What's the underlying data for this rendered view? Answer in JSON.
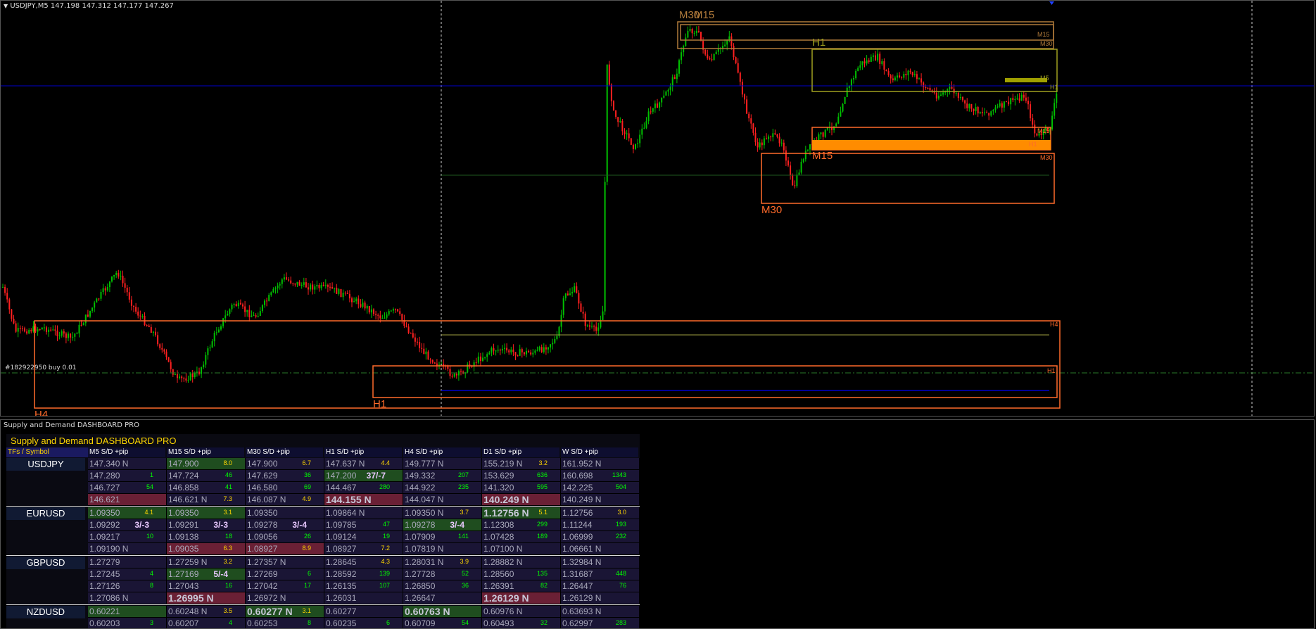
{
  "chart": {
    "title": "USDJPY,M5  147.198 147.312 147.177 147.267",
    "order_label": "#182922950 buy 0.01",
    "colors": {
      "bull": "#00c000",
      "bear": "#ff2020",
      "zone_orange": "#ff6a2a",
      "zone_tan": "#b07a3a",
      "zone_olive": "#a0a020",
      "fill_orange": "#ff8c00",
      "blue_line": "#0000cc",
      "grid_dashed": "#cccccc",
      "dashdot_green": "#2a7a2a"
    },
    "zone_labels": {
      "m30_m15_top": "M30",
      "m15_top": "M15",
      "h1_top": "H1",
      "m15_mid": "M15",
      "m30_mid": "M30",
      "h4_bottom": "H4",
      "h1_bottom": "H1"
    },
    "small_labels": {
      "m15_r1": "M15",
      "m30_r1": "M30",
      "m5_r": "M5",
      "h1_r": "H1",
      "m15_r2": "M15",
      "h1_r2": "H1",
      "m30_r2": "M30",
      "h4_r": "H4",
      "h1_r3": "H1"
    }
  },
  "panel": {
    "title": "Supply and Demand DASHBOARD PRO",
    "dashboard_title": "Supply and Demand DASHBOARD PRO",
    "col_first": "TFs / Symbol",
    "columns": [
      "M5 S/D +pip",
      "M15 S/D +pip",
      "M30 S/D +pip",
      "H1 S/D +pip",
      "H4 S/D +pip",
      "D1 S/D +pip",
      "W S/D +pip"
    ],
    "symbols": [
      {
        "name": "USDJPY",
        "rows": [
          [
            {
              "p": "147.340 N"
            },
            {
              "p": "147.900",
              "n": "8.0",
              "c": "y",
              "h": "g"
            },
            {
              "p": "147.900",
              "n": "6.7",
              "c": "y"
            },
            {
              "p": "147.637 N",
              "n": "4.4",
              "c": "y"
            },
            {
              "p": "149.777 N"
            },
            {
              "p": "155.219 N",
              "n": "3.2",
              "c": "y"
            },
            {
              "p": "161.952 N"
            }
          ],
          [
            {
              "p": "147.280",
              "n": "1",
              "c": "g"
            },
            {
              "p": "147.724",
              "n": "46",
              "c": "g"
            },
            {
              "p": "147.629",
              "n": "36",
              "c": "g"
            },
            {
              "p": "147.200",
              "r": "37/-7",
              "h": "g"
            },
            {
              "p": "149.332",
              "n": "207",
              "c": "g"
            },
            {
              "p": "153.629",
              "n": "636",
              "c": "g"
            },
            {
              "p": "160.698",
              "n": "1343",
              "c": "g"
            }
          ],
          [
            {
              "p": "146.727",
              "n": "54",
              "c": "g"
            },
            {
              "p": "146.858",
              "n": "41",
              "c": "g"
            },
            {
              "p": "146.580",
              "n": "69",
              "c": "g"
            },
            {
              "p": "144.467",
              "n": "280",
              "c": "g"
            },
            {
              "p": "144.922",
              "n": "235",
              "c": "g"
            },
            {
              "p": "141.320",
              "n": "595",
              "c": "g"
            },
            {
              "p": "142.225",
              "n": "504",
              "c": "g"
            }
          ],
          [
            {
              "p": "146.621",
              "h": "r"
            },
            {
              "p": "146.621 N",
              "n": "7.3",
              "c": "y"
            },
            {
              "p": "146.087 N",
              "n": "4.9",
              "c": "y"
            },
            {
              "p": "144.155 N",
              "h": "r",
              "b": 1
            },
            {
              "p": "144.047 N"
            },
            {
              "p": "140.249 N",
              "h": "r",
              "b": 1
            },
            {
              "p": "140.249 N"
            }
          ]
        ]
      },
      {
        "name": "EURUSD",
        "rows": [
          [
            {
              "p": "1.09350",
              "n": "4.1",
              "c": "y",
              "h": "g"
            },
            {
              "p": "1.09350",
              "n": "3.1",
              "c": "y",
              "h": "g"
            },
            {
              "p": "1.09350"
            },
            {
              "p": "1.09864 N"
            },
            {
              "p": "1.09350 N",
              "n": "3.7",
              "c": "y"
            },
            {
              "p": "1.12756 N",
              "n": "5.1",
              "c": "y",
              "h": "g",
              "b": 1
            },
            {
              "p": "1.12756",
              "n": "3.0",
              "c": "y"
            }
          ],
          [
            {
              "p": "1.09292",
              "r": "3/-3"
            },
            {
              "p": "1.09291",
              "r": "3/-3"
            },
            {
              "p": "1.09278",
              "r": "3/-4"
            },
            {
              "p": "1.09785",
              "n": "47",
              "c": "g"
            },
            {
              "p": "1.09278",
              "r": "3/-4",
              "h": "g"
            },
            {
              "p": "1.12308",
              "n": "299",
              "c": "g"
            },
            {
              "p": "1.11244",
              "n": "193",
              "c": "g"
            }
          ],
          [
            {
              "p": "1.09217",
              "n": "10",
              "c": "g"
            },
            {
              "p": "1.09138",
              "n": "18",
              "c": "g"
            },
            {
              "p": "1.09056",
              "n": "26",
              "c": "g"
            },
            {
              "p": "1.09124",
              "n": "19",
              "c": "g"
            },
            {
              "p": "1.07909",
              "n": "141",
              "c": "g"
            },
            {
              "p": "1.07428",
              "n": "189",
              "c": "g"
            },
            {
              "p": "1.06999",
              "n": "232",
              "c": "g"
            }
          ],
          [
            {
              "p": "1.09190 N"
            },
            {
              "p": "1.09035",
              "n": "6.3",
              "c": "y",
              "h": "r"
            },
            {
              "p": "1.08927",
              "n": "8.9",
              "c": "y",
              "h": "r"
            },
            {
              "p": "1.08927",
              "n": "7.2",
              "c": "y"
            },
            {
              "p": "1.07819 N"
            },
            {
              "p": "1.07100 N"
            },
            {
              "p": "1.06661 N"
            }
          ]
        ]
      },
      {
        "name": "GBPUSD",
        "rows": [
          [
            {
              "p": "1.27279"
            },
            {
              "p": "1.27259 N",
              "n": "3.2",
              "c": "y"
            },
            {
              "p": "1.27357 N"
            },
            {
              "p": "1.28645",
              "n": "4.3",
              "c": "y"
            },
            {
              "p": "1.28031 N",
              "n": "3.9",
              "c": "y"
            },
            {
              "p": "1.28882 N"
            },
            {
              "p": "1.32984 N"
            }
          ],
          [
            {
              "p": "1.27245",
              "n": "4",
              "c": "g"
            },
            {
              "p": "1.27169",
              "r": "5/-4",
              "h": "g"
            },
            {
              "p": "1.27269",
              "n": "6",
              "c": "g"
            },
            {
              "p": "1.28592",
              "n": "139",
              "c": "g"
            },
            {
              "p": "1.27728",
              "n": "52",
              "c": "g"
            },
            {
              "p": "1.28560",
              "n": "135",
              "c": "g"
            },
            {
              "p": "1.31687",
              "n": "448",
              "c": "g"
            }
          ],
          [
            {
              "p": "1.27126",
              "n": "8",
              "c": "g"
            },
            {
              "p": "1.27043",
              "n": "16",
              "c": "g"
            },
            {
              "p": "1.27042",
              "n": "17",
              "c": "g"
            },
            {
              "p": "1.26135",
              "n": "107",
              "c": "g"
            },
            {
              "p": "1.26850",
              "n": "36",
              "c": "g"
            },
            {
              "p": "1.26391",
              "n": "82",
              "c": "g"
            },
            {
              "p": "1.26447",
              "n": "76",
              "c": "g"
            }
          ],
          [
            {
              "p": "1.27086 N"
            },
            {
              "p": "1.26995 N",
              "h": "r",
              "b": 1
            },
            {
              "p": "1.26972 N"
            },
            {
              "p": "1.26031"
            },
            {
              "p": "1.26647"
            },
            {
              "p": "1.26129 N",
              "h": "r",
              "b": 1
            },
            {
              "p": "1.26129 N"
            }
          ]
        ]
      },
      {
        "name": "NZDUSD",
        "rows": [
          [
            {
              "p": "0.60221",
              "h": "g"
            },
            {
              "p": "0.60248 N",
              "n": "3.5",
              "c": "y"
            },
            {
              "p": "0.60277 N",
              "n": "3.1",
              "c": "y",
              "h": "g",
              "b": 1
            },
            {
              "p": "0.60277"
            },
            {
              "p": "0.60763 N",
              "h": "g",
              "b": 1
            },
            {
              "p": "0.60976 N"
            },
            {
              "p": "0.63693 N"
            }
          ],
          [
            {
              "p": "0.60203",
              "n": "3",
              "c": "g"
            },
            {
              "p": "0.60207",
              "n": "4",
              "c": "g"
            },
            {
              "p": "0.60253",
              "n": "8",
              "c": "g"
            },
            {
              "p": "0.60235",
              "n": "6",
              "c": "g"
            },
            {
              "p": "0.60709",
              "n": "54",
              "c": "g"
            },
            {
              "p": "0.60493",
              "n": "32",
              "c": "g"
            },
            {
              "p": "0.62997",
              "n": "283",
              "c": "g"
            }
          ]
        ]
      }
    ]
  }
}
